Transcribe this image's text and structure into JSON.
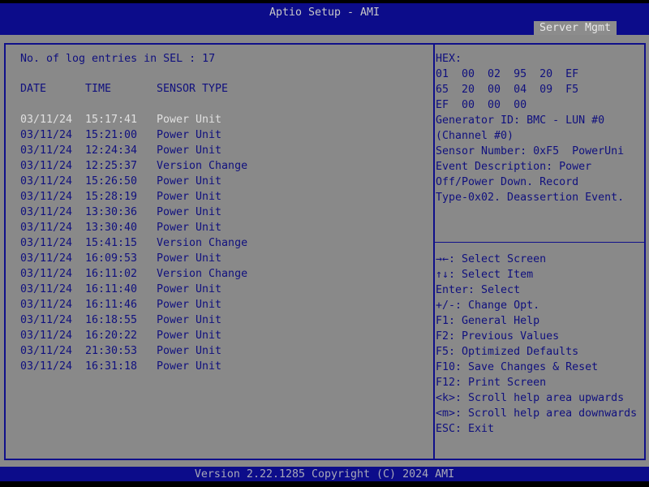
{
  "header": {
    "title": "Aptio Setup - AMI",
    "active_tab": "Server Mgmt"
  },
  "main": {
    "summary": "No. of log entries in SEL : 17",
    "columns": [
      "DATE",
      "TIME",
      "SENSOR TYPE"
    ],
    "selected_index": 0,
    "rows": [
      {
        "date": "03/11/24",
        "time": "15:17:41",
        "sensor": "Power Unit"
      },
      {
        "date": "03/11/24",
        "time": "15:21:00",
        "sensor": "Power Unit"
      },
      {
        "date": "03/11/24",
        "time": "12:24:34",
        "sensor": "Power Unit"
      },
      {
        "date": "03/11/24",
        "time": "12:25:37",
        "sensor": "Version Change"
      },
      {
        "date": "03/11/24",
        "time": "15:26:50",
        "sensor": "Power Unit"
      },
      {
        "date": "03/11/24",
        "time": "15:28:19",
        "sensor": "Power Unit"
      },
      {
        "date": "03/11/24",
        "time": "13:30:36",
        "sensor": "Power Unit"
      },
      {
        "date": "03/11/24",
        "time": "13:30:40",
        "sensor": "Power Unit"
      },
      {
        "date": "03/11/24",
        "time": "15:41:15",
        "sensor": "Version Change"
      },
      {
        "date": "03/11/24",
        "time": "16:09:53",
        "sensor": "Power Unit"
      },
      {
        "date": "03/11/24",
        "time": "16:11:02",
        "sensor": "Version Change"
      },
      {
        "date": "03/11/24",
        "time": "16:11:40",
        "sensor": "Power Unit"
      },
      {
        "date": "03/11/24",
        "time": "16:11:46",
        "sensor": "Power Unit"
      },
      {
        "date": "03/11/24",
        "time": "16:18:55",
        "sensor": "Power Unit"
      },
      {
        "date": "03/11/24",
        "time": "16:20:22",
        "sensor": "Power Unit"
      },
      {
        "date": "03/11/24",
        "time": "21:30:53",
        "sensor": "Power Unit"
      },
      {
        "date": "03/11/24",
        "time": "16:31:18",
        "sensor": "Power Unit"
      }
    ]
  },
  "details": [
    "HEX:",
    "01  00  02  95  20  EF",
    "65  20  00  04  09  F5",
    "EF  00  00  00",
    "Generator ID: BMC - LUN #0",
    "(Channel #0)",
    "Sensor Number: 0xF5  PowerUni",
    "Event Description: Power",
    "Off/Power Down. Record",
    "Type-0x02. Deassertion Event."
  ],
  "help": [
    "→←: Select Screen",
    "↑↓: Select Item",
    "Enter: Select",
    "+/-: Change Opt.",
    "F1: General Help",
    "F2: Previous Values",
    "F5: Optimized Defaults",
    "F10: Save Changes & Reset",
    "F12: Print Screen",
    "<k>: Scroll help area upwards",
    "<m>: Scroll help area downwards",
    "ESC: Exit"
  ],
  "footer": "Version 2.22.1285 Copyright (C) 2024 AMI",
  "colors": {
    "bar": "#0c0c8a",
    "background": "#898989",
    "text": "#10107e",
    "selected": "#e0e0e0"
  }
}
